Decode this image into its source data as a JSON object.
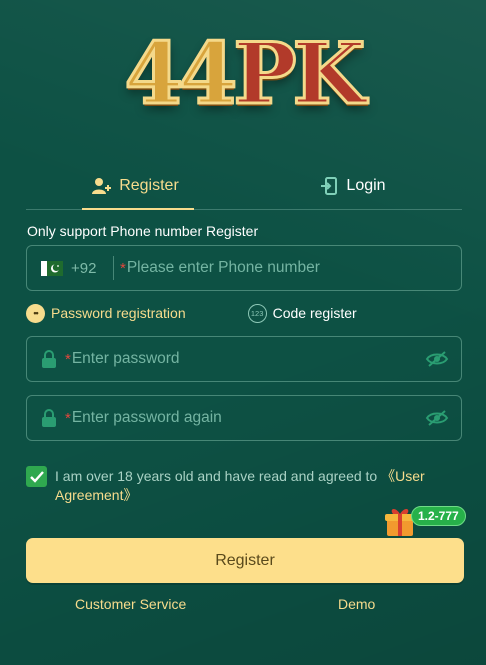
{
  "logo": {
    "text_a": "44",
    "text_b": "PK"
  },
  "tabs": [
    {
      "label": "Register",
      "icon": "user-add-icon",
      "active": true
    },
    {
      "label": "Login",
      "icon": "login-door-icon",
      "active": false
    }
  ],
  "hint": "Only support Phone number Register",
  "phone": {
    "country_code": "+92",
    "flag": "pakistan-flag-icon",
    "required_mark": "*",
    "placeholder": "Please enter Phone number"
  },
  "modes": [
    {
      "label": "Password registration",
      "icon": "password-dots-icon",
      "active": true
    },
    {
      "label": "Code register",
      "icon": "code-123-icon",
      "icon_text": "123",
      "active": false
    }
  ],
  "password": {
    "required_mark": "*",
    "placeholder": "Enter password",
    "icon": "lock-icon",
    "toggle_icon": "eye-hidden-icon"
  },
  "password_again": {
    "required_mark": "*",
    "placeholder": "Enter password again",
    "icon": "lock-icon",
    "toggle_icon": "eye-hidden-icon"
  },
  "agreement": {
    "checked": true,
    "text": "I am over 18 years old and have read and agreed to ",
    "link": "《User Agreement》"
  },
  "promo": {
    "icon": "gift-icon",
    "badge": "1.2-777"
  },
  "register_button": "Register",
  "footer": {
    "customer_service": "Customer Service",
    "demo": "Demo"
  },
  "colors": {
    "background": "#0d5144",
    "accent_gold": "#f7dc8d",
    "button": "#fddf8b",
    "required": "#e2473d",
    "check_green": "#2fa84f"
  }
}
